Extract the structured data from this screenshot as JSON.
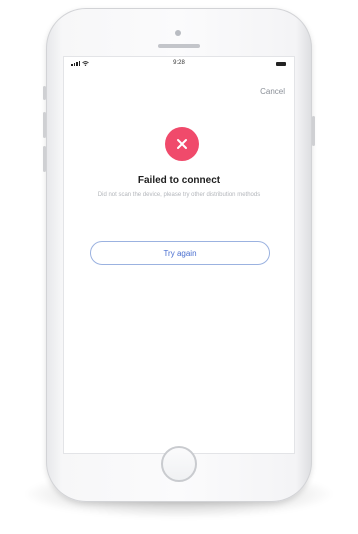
{
  "status_bar": {
    "time": "9:28"
  },
  "header": {
    "cancel_label": "Cancel"
  },
  "error": {
    "icon": "close-icon",
    "color": "#f04a6b",
    "title": "Failed to connect",
    "description": "Did not scan the device, please try other distribution methods"
  },
  "actions": {
    "retry_label": "Try again",
    "accent": "#4a6fd0"
  }
}
